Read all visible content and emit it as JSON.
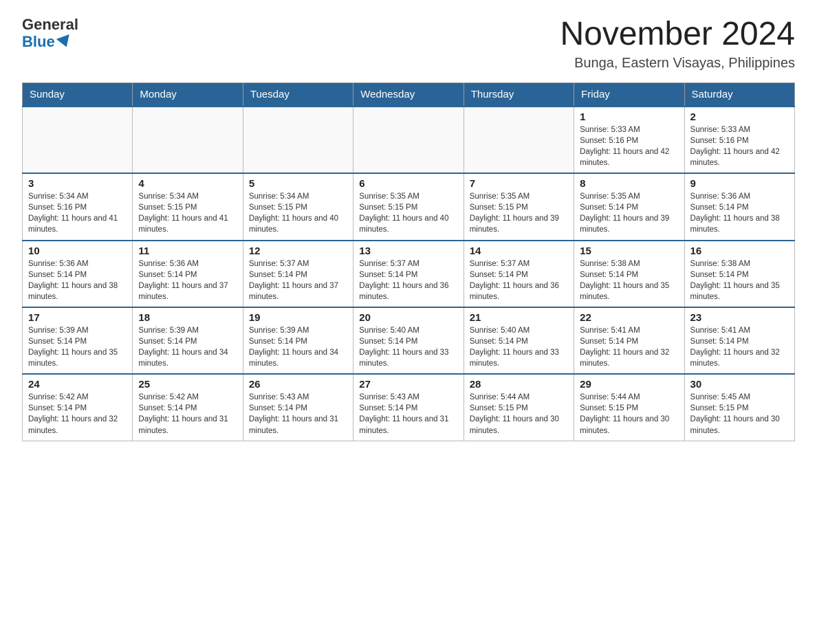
{
  "header": {
    "logo_general": "General",
    "logo_blue": "Blue",
    "month_title": "November 2024",
    "location": "Bunga, Eastern Visayas, Philippines"
  },
  "weekdays": [
    "Sunday",
    "Monday",
    "Tuesday",
    "Wednesday",
    "Thursday",
    "Friday",
    "Saturday"
  ],
  "weeks": [
    [
      {
        "day": "",
        "sunrise": "",
        "sunset": "",
        "daylight": ""
      },
      {
        "day": "",
        "sunrise": "",
        "sunset": "",
        "daylight": ""
      },
      {
        "day": "",
        "sunrise": "",
        "sunset": "",
        "daylight": ""
      },
      {
        "day": "",
        "sunrise": "",
        "sunset": "",
        "daylight": ""
      },
      {
        "day": "",
        "sunrise": "",
        "sunset": "",
        "daylight": ""
      },
      {
        "day": "1",
        "sunrise": "Sunrise: 5:33 AM",
        "sunset": "Sunset: 5:16 PM",
        "daylight": "Daylight: 11 hours and 42 minutes."
      },
      {
        "day": "2",
        "sunrise": "Sunrise: 5:33 AM",
        "sunset": "Sunset: 5:16 PM",
        "daylight": "Daylight: 11 hours and 42 minutes."
      }
    ],
    [
      {
        "day": "3",
        "sunrise": "Sunrise: 5:34 AM",
        "sunset": "Sunset: 5:16 PM",
        "daylight": "Daylight: 11 hours and 41 minutes."
      },
      {
        "day": "4",
        "sunrise": "Sunrise: 5:34 AM",
        "sunset": "Sunset: 5:15 PM",
        "daylight": "Daylight: 11 hours and 41 minutes."
      },
      {
        "day": "5",
        "sunrise": "Sunrise: 5:34 AM",
        "sunset": "Sunset: 5:15 PM",
        "daylight": "Daylight: 11 hours and 40 minutes."
      },
      {
        "day": "6",
        "sunrise": "Sunrise: 5:35 AM",
        "sunset": "Sunset: 5:15 PM",
        "daylight": "Daylight: 11 hours and 40 minutes."
      },
      {
        "day": "7",
        "sunrise": "Sunrise: 5:35 AM",
        "sunset": "Sunset: 5:15 PM",
        "daylight": "Daylight: 11 hours and 39 minutes."
      },
      {
        "day": "8",
        "sunrise": "Sunrise: 5:35 AM",
        "sunset": "Sunset: 5:14 PM",
        "daylight": "Daylight: 11 hours and 39 minutes."
      },
      {
        "day": "9",
        "sunrise": "Sunrise: 5:36 AM",
        "sunset": "Sunset: 5:14 PM",
        "daylight": "Daylight: 11 hours and 38 minutes."
      }
    ],
    [
      {
        "day": "10",
        "sunrise": "Sunrise: 5:36 AM",
        "sunset": "Sunset: 5:14 PM",
        "daylight": "Daylight: 11 hours and 38 minutes."
      },
      {
        "day": "11",
        "sunrise": "Sunrise: 5:36 AM",
        "sunset": "Sunset: 5:14 PM",
        "daylight": "Daylight: 11 hours and 37 minutes."
      },
      {
        "day": "12",
        "sunrise": "Sunrise: 5:37 AM",
        "sunset": "Sunset: 5:14 PM",
        "daylight": "Daylight: 11 hours and 37 minutes."
      },
      {
        "day": "13",
        "sunrise": "Sunrise: 5:37 AM",
        "sunset": "Sunset: 5:14 PM",
        "daylight": "Daylight: 11 hours and 36 minutes."
      },
      {
        "day": "14",
        "sunrise": "Sunrise: 5:37 AM",
        "sunset": "Sunset: 5:14 PM",
        "daylight": "Daylight: 11 hours and 36 minutes."
      },
      {
        "day": "15",
        "sunrise": "Sunrise: 5:38 AM",
        "sunset": "Sunset: 5:14 PM",
        "daylight": "Daylight: 11 hours and 35 minutes."
      },
      {
        "day": "16",
        "sunrise": "Sunrise: 5:38 AM",
        "sunset": "Sunset: 5:14 PM",
        "daylight": "Daylight: 11 hours and 35 minutes."
      }
    ],
    [
      {
        "day": "17",
        "sunrise": "Sunrise: 5:39 AM",
        "sunset": "Sunset: 5:14 PM",
        "daylight": "Daylight: 11 hours and 35 minutes."
      },
      {
        "day": "18",
        "sunrise": "Sunrise: 5:39 AM",
        "sunset": "Sunset: 5:14 PM",
        "daylight": "Daylight: 11 hours and 34 minutes."
      },
      {
        "day": "19",
        "sunrise": "Sunrise: 5:39 AM",
        "sunset": "Sunset: 5:14 PM",
        "daylight": "Daylight: 11 hours and 34 minutes."
      },
      {
        "day": "20",
        "sunrise": "Sunrise: 5:40 AM",
        "sunset": "Sunset: 5:14 PM",
        "daylight": "Daylight: 11 hours and 33 minutes."
      },
      {
        "day": "21",
        "sunrise": "Sunrise: 5:40 AM",
        "sunset": "Sunset: 5:14 PM",
        "daylight": "Daylight: 11 hours and 33 minutes."
      },
      {
        "day": "22",
        "sunrise": "Sunrise: 5:41 AM",
        "sunset": "Sunset: 5:14 PM",
        "daylight": "Daylight: 11 hours and 32 minutes."
      },
      {
        "day": "23",
        "sunrise": "Sunrise: 5:41 AM",
        "sunset": "Sunset: 5:14 PM",
        "daylight": "Daylight: 11 hours and 32 minutes."
      }
    ],
    [
      {
        "day": "24",
        "sunrise": "Sunrise: 5:42 AM",
        "sunset": "Sunset: 5:14 PM",
        "daylight": "Daylight: 11 hours and 32 minutes."
      },
      {
        "day": "25",
        "sunrise": "Sunrise: 5:42 AM",
        "sunset": "Sunset: 5:14 PM",
        "daylight": "Daylight: 11 hours and 31 minutes."
      },
      {
        "day": "26",
        "sunrise": "Sunrise: 5:43 AM",
        "sunset": "Sunset: 5:14 PM",
        "daylight": "Daylight: 11 hours and 31 minutes."
      },
      {
        "day": "27",
        "sunrise": "Sunrise: 5:43 AM",
        "sunset": "Sunset: 5:14 PM",
        "daylight": "Daylight: 11 hours and 31 minutes."
      },
      {
        "day": "28",
        "sunrise": "Sunrise: 5:44 AM",
        "sunset": "Sunset: 5:15 PM",
        "daylight": "Daylight: 11 hours and 30 minutes."
      },
      {
        "day": "29",
        "sunrise": "Sunrise: 5:44 AM",
        "sunset": "Sunset: 5:15 PM",
        "daylight": "Daylight: 11 hours and 30 minutes."
      },
      {
        "day": "30",
        "sunrise": "Sunrise: 5:45 AM",
        "sunset": "Sunset: 5:15 PM",
        "daylight": "Daylight: 11 hours and 30 minutes."
      }
    ]
  ]
}
